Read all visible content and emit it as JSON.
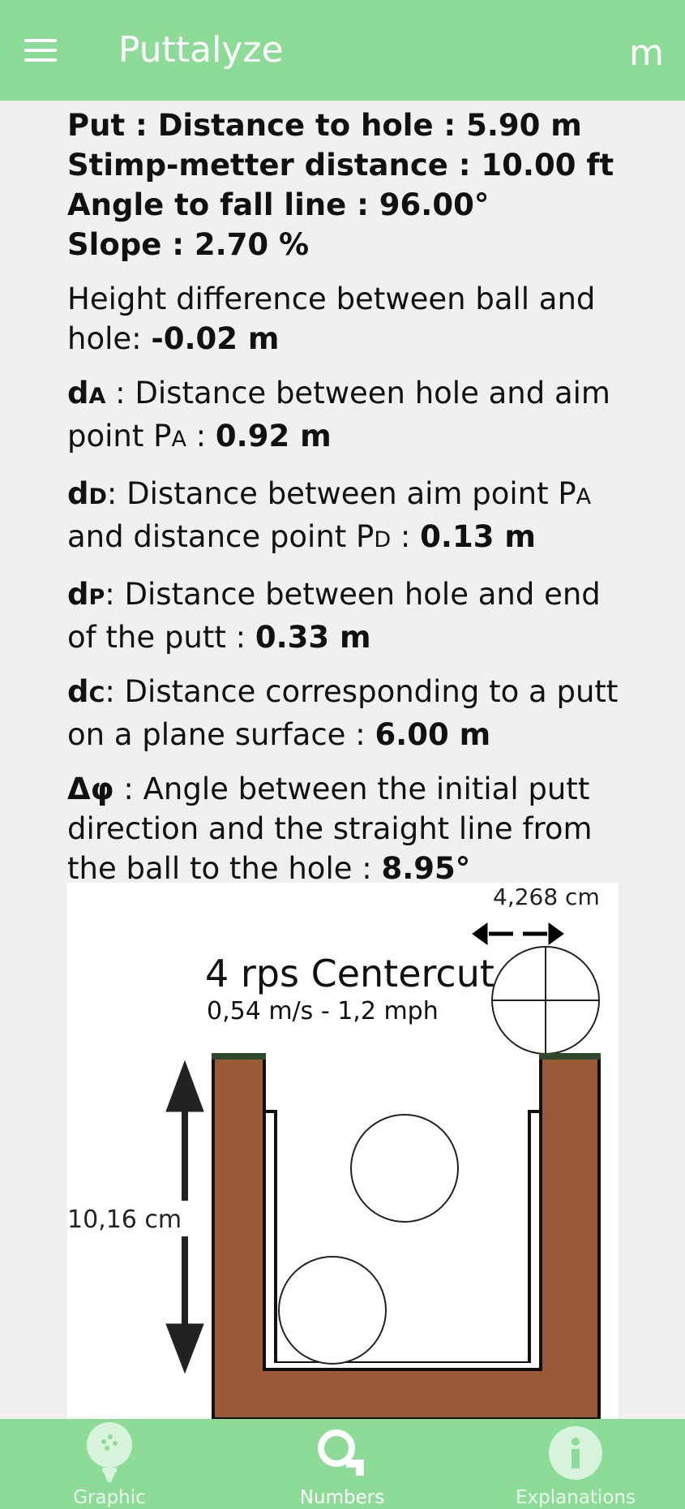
{
  "app": {
    "title": "Puttalyze",
    "unit_toggle": "m"
  },
  "summary": {
    "line1": "Put : Distance to hole : 5.90 m",
    "line2": "Stimp-metter distance : 10.00 ft",
    "line3": "Angle to fall line : 96.00°",
    "line4": "Slope : 2.70 %"
  },
  "metrics": {
    "height": {
      "text": "Height difference between ball and hole: ",
      "value": "-0.02 m"
    },
    "da": {
      "sym": "d",
      "sub": "A",
      "text_a": " : Distance between hole and aim point P",
      "sub2": "A",
      "text_b": " : ",
      "value": "0.92 m"
    },
    "dd": {
      "sym": "d",
      "sub": "D",
      "text_a": ": Distance between aim point P",
      "sub2": "A",
      "text_b": " and distance point P",
      "sub3": "D",
      "text_c": " : ",
      "value": "0.13 m"
    },
    "dp": {
      "sym": "d",
      "sub": "P",
      "text_a": ": Distance between hole and end of the putt : ",
      "value": "0.33 m"
    },
    "dc": {
      "sym": "d",
      "sub": "C",
      "text_a": ": Distance corresponding to a putt on a plane surface : ",
      "value": "6.00 m"
    },
    "dphi": {
      "sym": "Δφ",
      "text_a": " : Angle between the initial putt direction and the straight line from the ball to the hole : ",
      "value": "8.95°"
    }
  },
  "diagram": {
    "ball_width_label": "4,268 cm",
    "title": "4 rps Centercut",
    "speed": "0,54 m/s - 1,2 mph",
    "depth_label": "10,16 cm",
    "soil_color": "#9a5a38"
  },
  "nav": {
    "graphic": "Graphic",
    "numbers": "Numbers",
    "explanations": "Explanations"
  },
  "colors": {
    "bar": "#8cdc98"
  }
}
